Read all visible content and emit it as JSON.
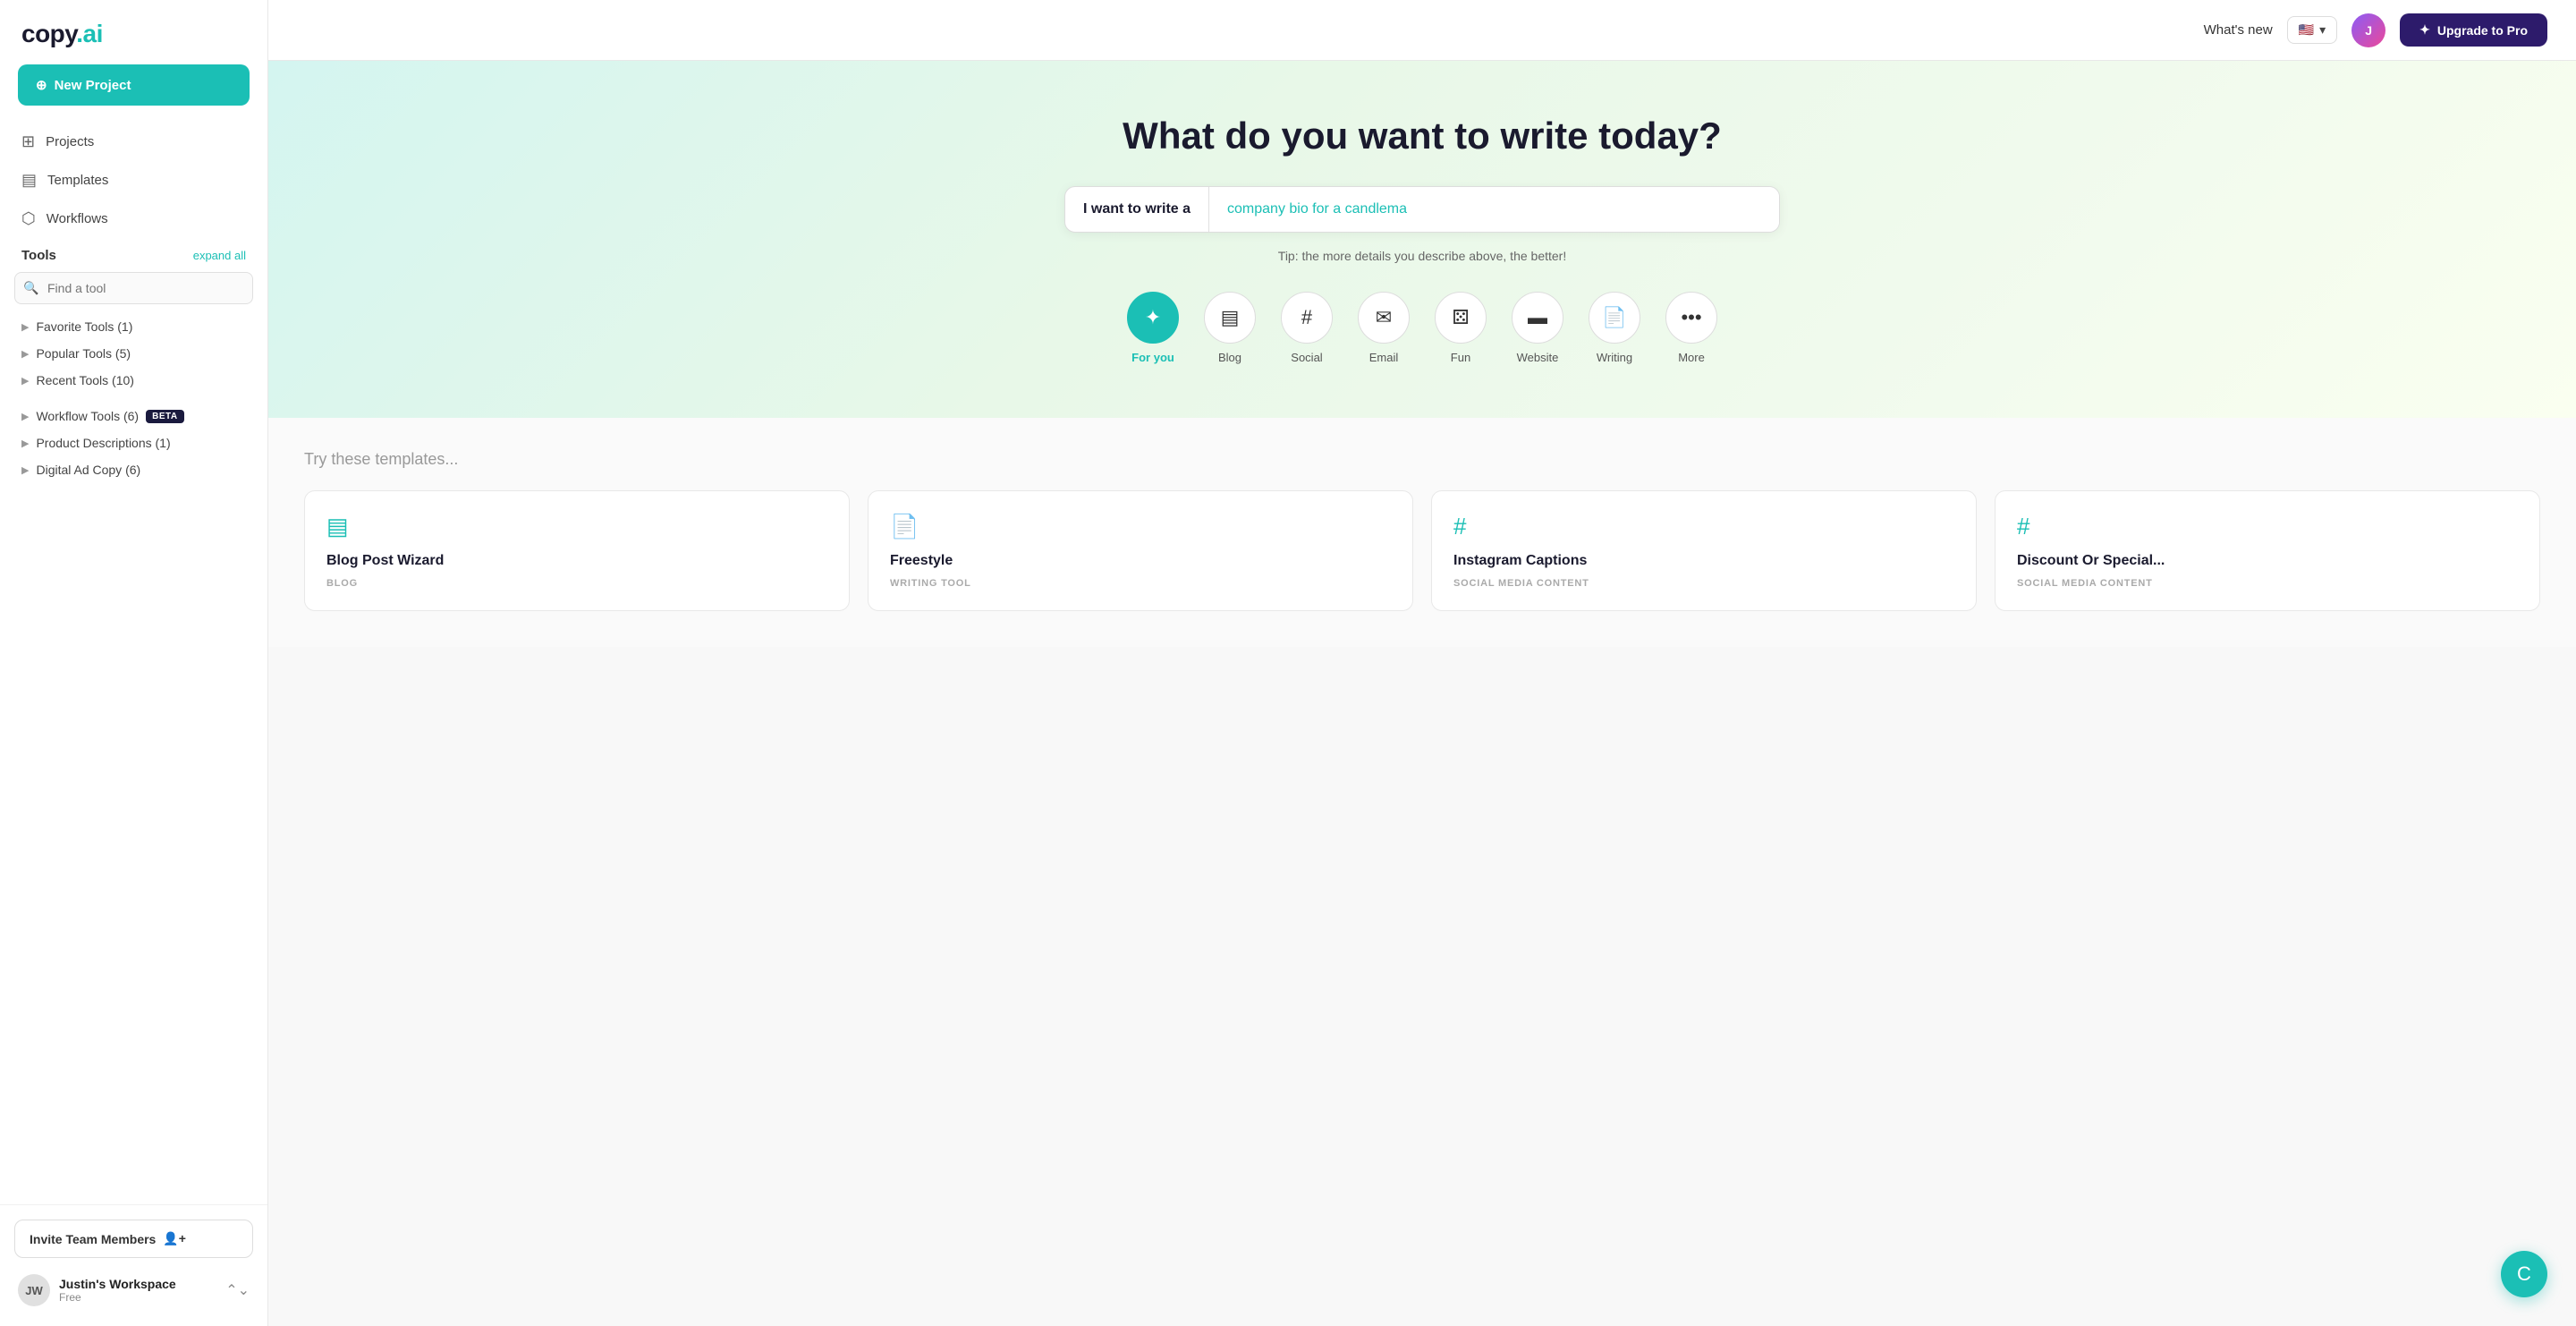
{
  "brand": {
    "name_part1": "copy",
    "name_part2": ".ai"
  },
  "sidebar": {
    "new_project_label": "New Project",
    "nav_items": [
      {
        "id": "projects",
        "label": "Projects",
        "icon": "⊞"
      },
      {
        "id": "templates",
        "label": "Templates",
        "icon": "▤"
      },
      {
        "id": "workflows",
        "label": "Workflows",
        "icon": "⬡"
      }
    ],
    "tools_header": "Tools",
    "expand_all_label": "expand all",
    "search_placeholder": "Find a tool",
    "tool_categories": [
      {
        "id": "favorite",
        "label": "Favorite Tools (1)",
        "badge": null
      },
      {
        "id": "popular",
        "label": "Popular Tools (5)",
        "badge": null
      },
      {
        "id": "recent",
        "label": "Recent Tools (10)",
        "badge": null
      },
      {
        "id": "workflow",
        "label": "Workflow Tools (6)",
        "badge": "BETA"
      },
      {
        "id": "product",
        "label": "Product Descriptions (1)",
        "badge": null
      },
      {
        "id": "digital",
        "label": "Digital Ad Copy (6)",
        "badge": null
      }
    ],
    "invite_label": "Invite Team Members",
    "workspace": {
      "initials": "JW",
      "name": "Justin's Workspace",
      "plan": "Free"
    }
  },
  "topbar": {
    "whats_new_label": "What's new",
    "lang_code": "🇺🇸",
    "upgrade_label": "Upgrade to Pro",
    "upgrade_icon": "✦"
  },
  "hero": {
    "title": "What do you want to write today?",
    "input_label": "I want to write a",
    "input_value": "company bio for a candlema",
    "tip_text": "Tip: the more details you describe above, the better!",
    "categories": [
      {
        "id": "for-you",
        "label": "For you",
        "icon": "✦",
        "active": true
      },
      {
        "id": "blog",
        "label": "Blog",
        "icon": "▤",
        "active": false
      },
      {
        "id": "social",
        "label": "Social",
        "icon": "#",
        "active": false
      },
      {
        "id": "email",
        "label": "Email",
        "icon": "✉",
        "active": false
      },
      {
        "id": "fun",
        "label": "Fun",
        "icon": "⚄",
        "active": false
      },
      {
        "id": "website",
        "label": "Website",
        "icon": "▬",
        "active": false
      },
      {
        "id": "writing",
        "label": "Writing",
        "icon": "📄",
        "active": false
      },
      {
        "id": "more",
        "label": "More",
        "icon": "•••",
        "active": false
      }
    ]
  },
  "templates": {
    "section_title": "Try these templates...",
    "cards": [
      {
        "id": "blog-post-wizard",
        "name": "Blog Post Wizard",
        "category": "BLOG",
        "icon": "▤"
      },
      {
        "id": "freestyle",
        "name": "Freestyle",
        "category": "WRITING TOOL",
        "icon": "📄"
      },
      {
        "id": "instagram-captions",
        "name": "Instagram Captions",
        "category": "SOCIAL MEDIA CONTENT",
        "icon": "#"
      },
      {
        "id": "discount-or-special",
        "name": "Discount Or Special...",
        "category": "SOCIAL MEDIA CONTENT",
        "icon": "#"
      }
    ]
  },
  "colors": {
    "teal": "#1bbfb5",
    "dark": "#1a1a2e",
    "beta_bg": "#1a1a3e"
  }
}
